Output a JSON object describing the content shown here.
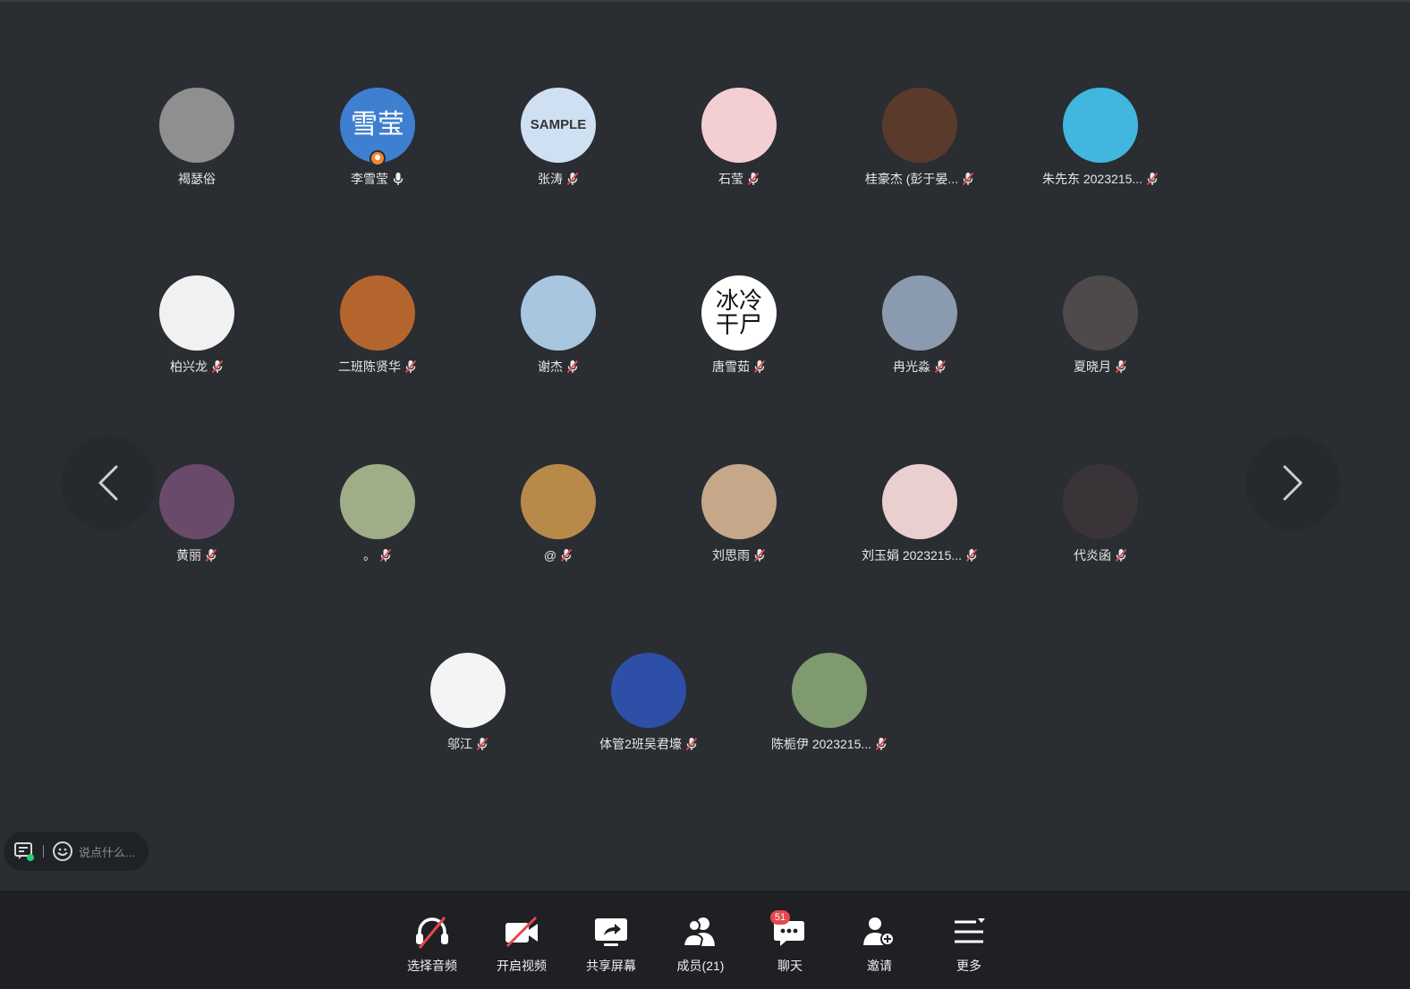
{
  "participants": [
    {
      "name": "褐瑟俗",
      "mic": "none",
      "avatar_bg": "#8f8f8f",
      "avatar_text": ""
    },
    {
      "name": "李雪莹",
      "mic": "on",
      "host": true,
      "avatar_bg": "#3f7fd0",
      "avatar_text": "雪莹"
    },
    {
      "name": "张涛",
      "mic": "muted",
      "avatar_bg": "#cfe0f2",
      "avatar_text": "SAMPLE"
    },
    {
      "name": "石莹",
      "mic": "muted",
      "avatar_bg": "#f3cfd2",
      "avatar_text": ""
    },
    {
      "name": "桂豪杰 (彭于晏...",
      "mic": "muted",
      "avatar_bg": "#5a3a2a",
      "avatar_text": ""
    },
    {
      "name": "朱先东 2023215...",
      "mic": "muted",
      "avatar_bg": "#41b7e0",
      "avatar_text": ""
    },
    {
      "name": "柏兴龙",
      "mic": "muted",
      "avatar_bg": "#f1f1f1",
      "avatar_text": ""
    },
    {
      "name": "二班陈贤华",
      "mic": "muted",
      "avatar_bg": "#b4652e",
      "avatar_text": ""
    },
    {
      "name": "谢杰",
      "mic": "muted",
      "avatar_bg": "#a8c6e0",
      "avatar_text": ""
    },
    {
      "name": "唐雪茹",
      "mic": "muted",
      "avatar_bg": "#ffffff",
      "avatar_text": "冰冷\n干尸"
    },
    {
      "name": "冉光淼",
      "mic": "muted",
      "avatar_bg": "#8a9bb0",
      "avatar_text": ""
    },
    {
      "name": "夏晓月",
      "mic": "muted",
      "avatar_bg": "#4e4a4c",
      "avatar_text": ""
    },
    {
      "name": "黄丽",
      "mic": "muted",
      "avatar_bg": "#6a4a6a",
      "avatar_text": ""
    },
    {
      "name": "。",
      "mic": "muted",
      "avatar_bg": "#9fae86",
      "avatar_text": ""
    },
    {
      "name": "@",
      "mic": "muted",
      "avatar_bg": "#b88a4a",
      "avatar_text": ""
    },
    {
      "name": "刘思雨",
      "mic": "muted",
      "avatar_bg": "#c7a78a",
      "avatar_text": ""
    },
    {
      "name": "刘玉娟 2023215...",
      "mic": "muted",
      "avatar_bg": "#e9d0ce",
      "avatar_text": ""
    },
    {
      "name": "代炎函",
      "mic": "muted",
      "avatar_bg": "#3a3438",
      "avatar_text": ""
    },
    {
      "name": "邬江",
      "mic": "muted",
      "avatar_bg": "#f4f4f4",
      "avatar_text": ""
    },
    {
      "name": "体管2班吴君壕",
      "mic": "muted",
      "avatar_bg": "#2d4fa8",
      "avatar_text": ""
    },
    {
      "name": "陈栀伊 2023215...",
      "mic": "muted",
      "avatar_bg": "#7e9a6e",
      "avatar_text": ""
    }
  ],
  "chat": {
    "placeholder": "说点什么..."
  },
  "toolbar": {
    "audio_label": "选择音频",
    "video_label": "开启视频",
    "share_label": "共享屏幕",
    "members_label": "成员(21)",
    "chat_label": "聊天",
    "chat_badge": "51",
    "invite_label": "邀请",
    "more_label": "更多"
  },
  "colors": {
    "background": "#2a2d32",
    "toolbar": "#1e2024",
    "host_badge": "#f08a2c",
    "unread_badge": "#e5484d",
    "muted_slash": "#e5484d"
  }
}
